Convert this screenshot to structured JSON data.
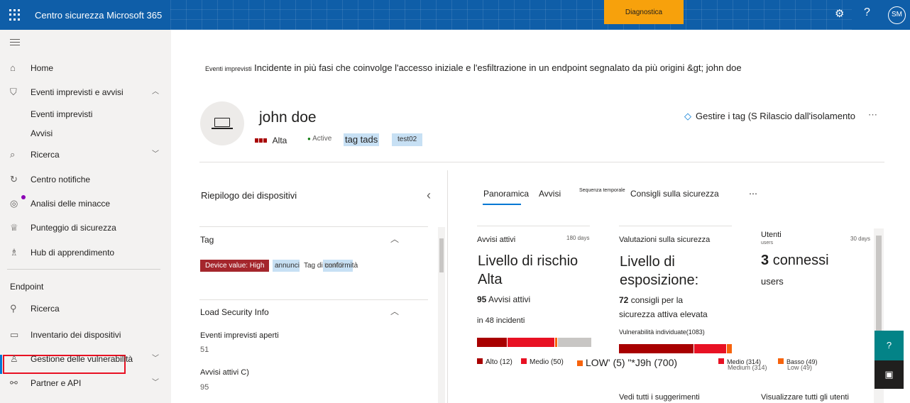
{
  "topbar": {
    "title": "Centro sicurezza Microsoft 365",
    "banner_button": "Diagnostica",
    "avatar": "SM",
    "help": "?",
    "settings_glyph": "⚙"
  },
  "sidebar": {
    "home": "Home",
    "incidents": "Eventi imprevisti e avvisi",
    "incidents_sub1": "Eventi imprevisti",
    "incidents_sub2": "Avvisi",
    "hunting": "Ricerca",
    "notifications": "Centro notifiche",
    "threat": "Analisi delle minacce",
    "score": "Punteggio di sicurezza",
    "learning": "Hub di apprendimento",
    "section": "Endpoint",
    "ep_search": "Ricerca",
    "inventory": "Inventario dei dispositivi",
    "vuln": "Gestione delle vulnerabilità",
    "partners": "Partner e API"
  },
  "header": {
    "crumb_small": "Eventi imprevisti",
    "crumb": "Incidente in più fasi che coinvolge l'accesso iniziale e l'esfiltrazione in un endpoint segnalato da più origini &gt; john doe"
  },
  "device": {
    "name": "john doe",
    "risk": "Alta",
    "status": "Active",
    "tag1": "tag tads",
    "tag2": "test02",
    "manage": "Gestire i tag (S Rilascio dall'isolamento",
    "more": "⋯"
  },
  "left_panel": {
    "title": "Riepilogo dei dispositivi",
    "tag_header": "Tag",
    "device_value": "Device value: High",
    "tag_a": "annunci",
    "tag_b": "Tag di conformità",
    "tag_c": "test02",
    "load_header": "Load Security Info",
    "open_incidents_label": "Eventi imprevisti aperti",
    "open_incidents": "51",
    "active_alerts_label": "Avvisi attivi C)",
    "active_alerts": "95"
  },
  "tabs": {
    "t1": "Panoramica",
    "t2": "Avvisi",
    "t3_small": "Sequenza temporale",
    "t4": "Consigli sulla sicurezza",
    "more": "⋯"
  },
  "cards": {
    "alerts": {
      "title": "Avvisi attivi",
      "period": "180 days",
      "big1": "Livello di rischio",
      "big2": "Alta",
      "count": "95",
      "count_label": "Avvisi attivi",
      "incidents": "in 48 incidenti",
      "leg_high": "Alto (12)",
      "leg_med": "Medio (50)",
      "leg_low": "LOW' (5) \"*J9h (700)"
    },
    "exposure": {
      "title": "Valutazioni sulla sicurezza",
      "big1": "Livello di",
      "big2": "esposizione:",
      "count": "72",
      "line1": "consigli per la",
      "line2": "sicurezza attiva elevata",
      "vuln": "Vulnerabilità individuate(1083)",
      "leg_med": "Medio (314)",
      "leg_med2": "Medium (314)",
      "leg_low": "Basso (49)",
      "leg_low2": "Low (49)",
      "link": "Vedi tutti i suggerimenti"
    },
    "users": {
      "title": "Utenti",
      "subtitle": "users",
      "period": "30 days",
      "count": "3",
      "count_label": "connessi",
      "label": "users",
      "link": "Visualizzare tutti gli utenti"
    }
  },
  "alerts_distribution": {
    "high": 12,
    "medium": 50,
    "low": 5,
    "informational": 700
  },
  "colors": {
    "topbar": "#0f5ea8",
    "banner": "#f7a10c",
    "high": "#a80000",
    "medium": "#e81123",
    "low": "#f7630c",
    "info": "#c8c6c4",
    "help": "#038387"
  }
}
